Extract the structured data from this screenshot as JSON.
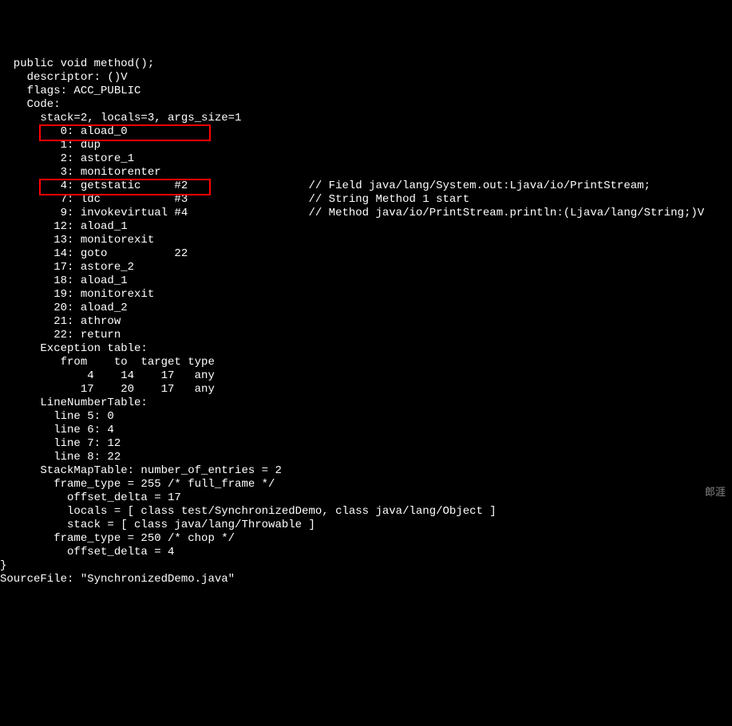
{
  "lines": [
    {
      "indent": 1,
      "text": "public void method();",
      "comment": ""
    },
    {
      "indent": 2,
      "text": "descriptor: ()V",
      "comment": ""
    },
    {
      "indent": 2,
      "text": "flags: ACC_PUBLIC",
      "comment": ""
    },
    {
      "indent": 2,
      "text": "Code:",
      "comment": ""
    },
    {
      "indent": 3,
      "text": "stack=2, locals=3, args_size=1",
      "comment": ""
    },
    {
      "indent": 4,
      "text": " 0: aload_0",
      "comment": ""
    },
    {
      "indent": 4,
      "text": " 1: dup",
      "comment": ""
    },
    {
      "indent": 4,
      "text": " 2: astore_1",
      "comment": ""
    },
    {
      "indent": 4,
      "text": " 3: monitorenter",
      "comment": ""
    },
    {
      "indent": 4,
      "text": " 4: getstatic     #2",
      "comment": "// Field java/lang/System.out:Ljava/io/PrintStream;"
    },
    {
      "indent": 4,
      "text": " 7: ldc           #3",
      "comment": "// String Method 1 start"
    },
    {
      "indent": 4,
      "text": " 9: invokevirtual #4",
      "comment": "// Method java/io/PrintStream.println:(Ljava/lang/String;)V"
    },
    {
      "indent": 4,
      "text": "12: aload_1",
      "comment": ""
    },
    {
      "indent": 4,
      "text": "13: monitorexit",
      "comment": ""
    },
    {
      "indent": 4,
      "text": "14: goto          22",
      "comment": ""
    },
    {
      "indent": 4,
      "text": "17: astore_2",
      "comment": ""
    },
    {
      "indent": 4,
      "text": "18: aload_1",
      "comment": ""
    },
    {
      "indent": 4,
      "text": "19: monitorexit",
      "comment": ""
    },
    {
      "indent": 4,
      "text": "20: aload_2",
      "comment": ""
    },
    {
      "indent": 4,
      "text": "21: athrow",
      "comment": ""
    },
    {
      "indent": 4,
      "text": "22: return",
      "comment": ""
    },
    {
      "indent": 3,
      "text": "Exception table:",
      "comment": ""
    },
    {
      "indent": 4,
      "text": " from    to  target type",
      "comment": ""
    },
    {
      "indent": 4,
      "text": "     4    14    17   any",
      "comment": ""
    },
    {
      "indent": 4,
      "text": "    17    20    17   any",
      "comment": ""
    },
    {
      "indent": 3,
      "text": "LineNumberTable:",
      "comment": ""
    },
    {
      "indent": 4,
      "text": "line 5: 0",
      "comment": ""
    },
    {
      "indent": 4,
      "text": "line 6: 4",
      "comment": ""
    },
    {
      "indent": 4,
      "text": "line 7: 12",
      "comment": ""
    },
    {
      "indent": 4,
      "text": "line 8: 22",
      "comment": ""
    },
    {
      "indent": 3,
      "text": "StackMapTable: number_of_entries = 2",
      "comment": ""
    },
    {
      "indent": 4,
      "text": "frame_type = 255 /* full_frame */",
      "comment": ""
    },
    {
      "indent": 5,
      "text": "offset_delta = 17",
      "comment": ""
    },
    {
      "indent": 5,
      "text": "locals = [ class test/SynchronizedDemo, class java/lang/Object ]",
      "comment": ""
    },
    {
      "indent": 5,
      "text": "stack = [ class java/lang/Throwable ]",
      "comment": ""
    },
    {
      "indent": 4,
      "text": "frame_type = 250 /* chop */",
      "comment": ""
    },
    {
      "indent": 5,
      "text": "offset_delta = 4",
      "comment": ""
    },
    {
      "indent": 0,
      "text": "}",
      "comment": ""
    },
    {
      "indent": 0,
      "text": "SourceFile: \"SynchronizedDemo.java\"",
      "comment": ""
    }
  ],
  "highlight_color": "#ff0000",
  "watermark": "郎涯",
  "indent_unit": "  ",
  "comment_column": 368
}
